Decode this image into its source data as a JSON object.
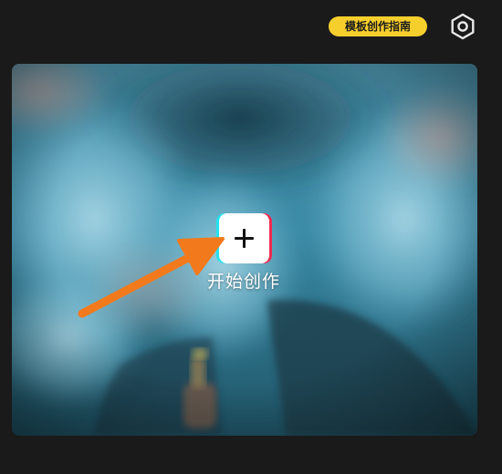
{
  "header": {
    "template_guide_label": "模板创作指南",
    "settings_icon": "settings-icon"
  },
  "hero": {
    "create_label": "开始创作",
    "create_icon": "plus-icon"
  },
  "colors": {
    "background": "#1a1a1a",
    "accent_yellow": "#f7cf2d",
    "annotation_orange": "#f27a1c",
    "glitch_cyan": "#22e3ee",
    "glitch_red": "#f2294f"
  }
}
